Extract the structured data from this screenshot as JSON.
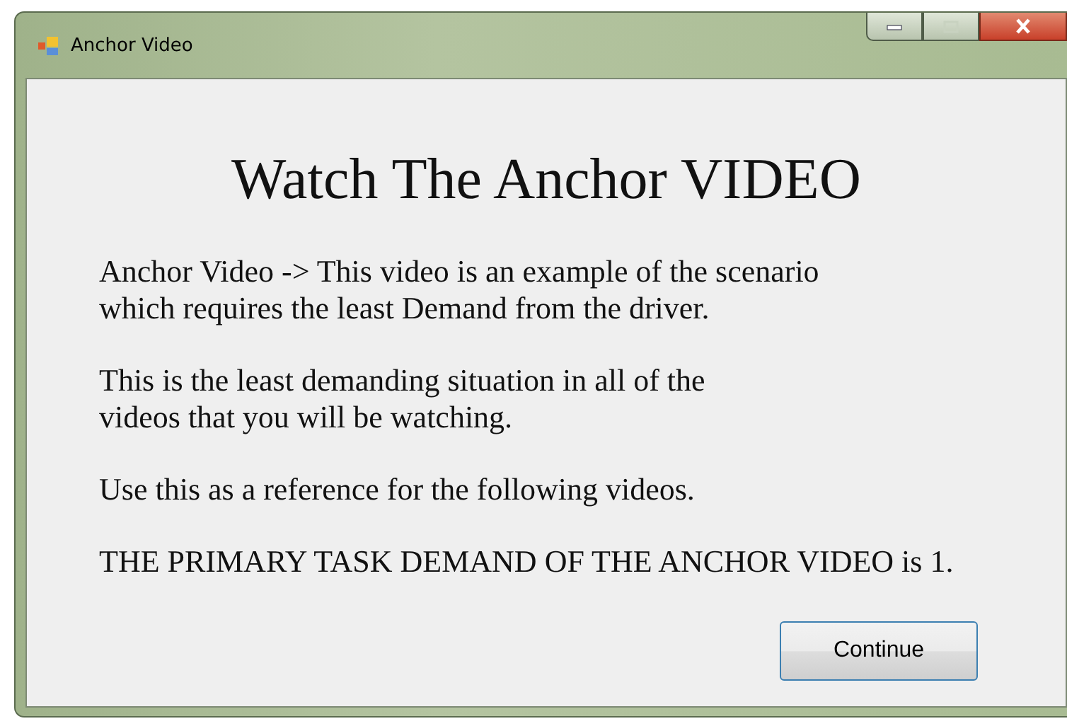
{
  "window": {
    "title": "Anchor Video",
    "maximize_disabled": true
  },
  "heading": "Watch The Anchor VIDEO",
  "paragraphs": [
    {
      "lines": [
        "Anchor Video -> This video is an example of the scenario",
        "which requires the least Demand from the driver."
      ]
    },
    {
      "lines": [
        "This is the least demanding situation in all of the",
        "videos that you will be watching."
      ]
    },
    {
      "lines": [
        "Use this as a reference for the following videos."
      ]
    },
    {
      "lines": [
        "THE PRIMARY TASK DEMAND OF THE ANCHOR VIDEO is 1."
      ]
    }
  ],
  "buttons": [
    {
      "label": "Continue"
    }
  ]
}
